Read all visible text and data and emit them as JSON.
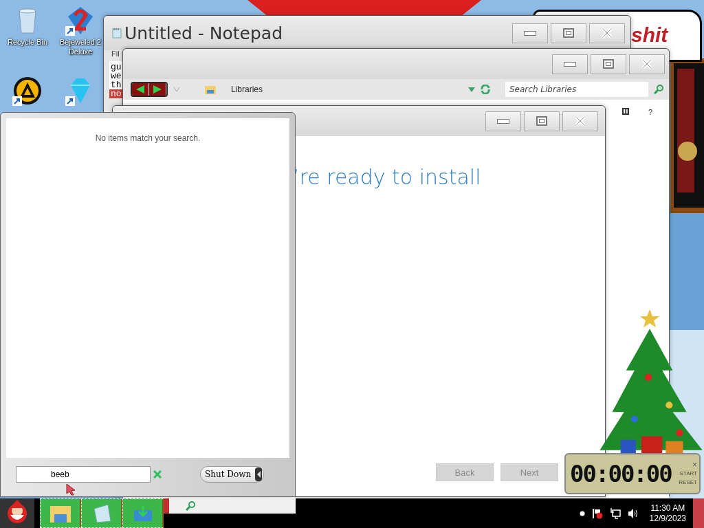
{
  "desktop": {
    "icons": [
      {
        "label": "Recycle Bin",
        "kind": "bin",
        "shortcut": false
      },
      {
        "label": "Bejeweled 2 Deluxe",
        "kind": "two",
        "shortcut": true
      },
      {
        "kind": "aimp",
        "shortcut": true
      },
      {
        "kind": "gem",
        "shortcut": true
      }
    ],
    "banner": {
      "text": "shit"
    }
  },
  "notepad": {
    "title": "Untitled - Notepad",
    "menu": "Fil",
    "lines": [
      {
        "text": "gu",
        "selected": false
      },
      {
        "text": "we",
        "selected": false
      },
      {
        "text": "th",
        "selected": false
      },
      {
        "text": "no",
        "selected": true
      }
    ]
  },
  "explorer": {
    "address": "Libraries",
    "search": {
      "placeholder": "Search Libraries"
    },
    "help": "?"
  },
  "installer": {
    "heading": "’re ready to install",
    "buttons": [
      {
        "label": "Back",
        "disabled": true
      },
      {
        "label": "Next",
        "disabled": true
      }
    ]
  },
  "start_menu": {
    "message": "No items match your search.",
    "search": {
      "value": "beeb"
    },
    "shutdown": "Shut Down"
  },
  "stopwatch": {
    "reading": "00:00:00",
    "close": "×",
    "buttons": [
      "START",
      "RESET"
    ]
  },
  "taskbar": {
    "pinned": [
      {
        "kind": "folder"
      },
      {
        "kind": "notepad"
      },
      {
        "kind": "setup"
      }
    ],
    "time": "11:30 AM",
    "date": "12/9/2023"
  }
}
